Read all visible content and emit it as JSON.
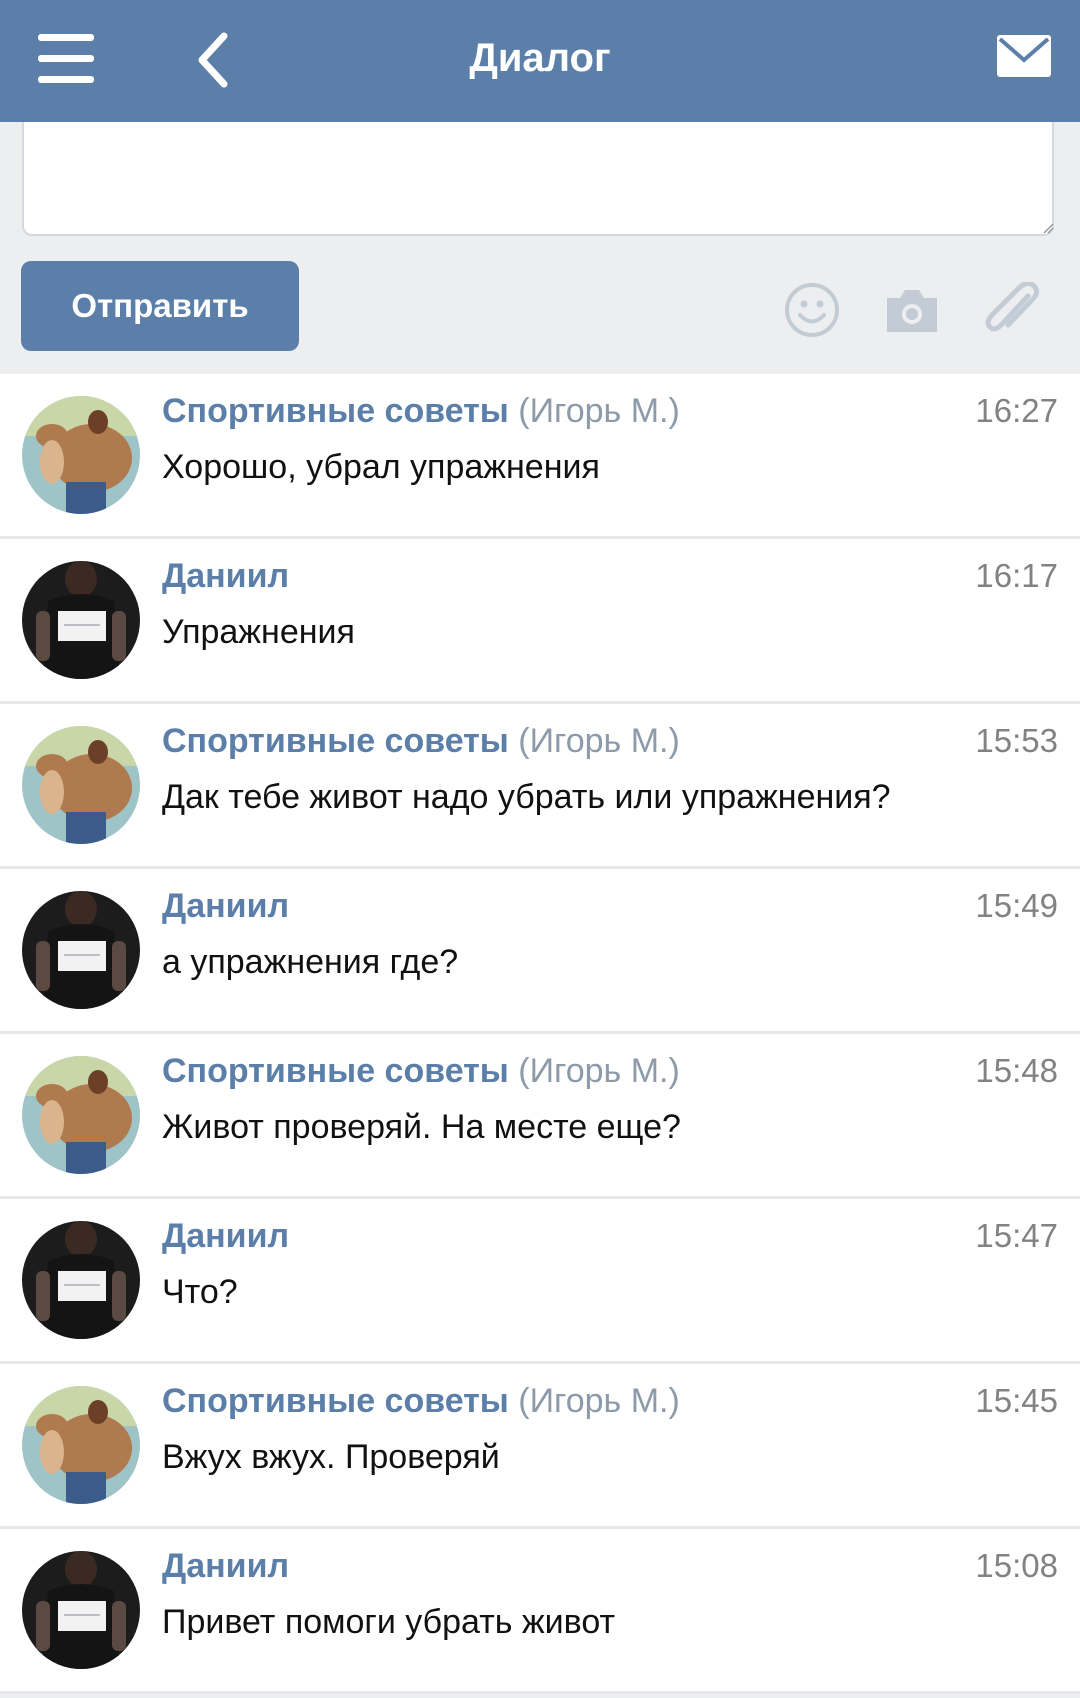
{
  "header": {
    "title": "Диалог",
    "menu_icon": "hamburger-icon",
    "back_icon": "chevron-left-icon",
    "mail_icon": "envelope-icon"
  },
  "composer": {
    "message_value": "",
    "send_label": "Отправить",
    "tools": [
      "emoji-icon",
      "camera-icon",
      "paperclip-icon"
    ]
  },
  "colors": {
    "header_bg": "#5b7fa8",
    "accent": "#5b7fa8",
    "page_bg": "#edeef0"
  },
  "messages": [
    {
      "sender": "Спортивные советы",
      "sender_sub": "(Игорь М.)",
      "time": "16:27",
      "text": "Хорошо, убрал упражнения",
      "avatar": "bodybuilder"
    },
    {
      "sender": "Даниил",
      "sender_sub": "",
      "time": "16:17",
      "text": "Упражнения",
      "avatar": "person-sign"
    },
    {
      "sender": "Спортивные советы",
      "sender_sub": "(Игорь М.)",
      "time": "15:53",
      "text": "Дак тебе живот надо убрать или упражнения?",
      "avatar": "bodybuilder"
    },
    {
      "sender": "Даниил",
      "sender_sub": "",
      "time": "15:49",
      "text": "а упражнения где?",
      "avatar": "person-sign"
    },
    {
      "sender": "Спортивные советы",
      "sender_sub": "(Игорь М.)",
      "time": "15:48",
      "text": "Живот проверяй. На месте еще?",
      "avatar": "bodybuilder"
    },
    {
      "sender": "Даниил",
      "sender_sub": "",
      "time": "15:47",
      "text": "Что?",
      "avatar": "person-sign"
    },
    {
      "sender": "Спортивные советы",
      "sender_sub": "(Игорь М.)",
      "time": "15:45",
      "text": "Вжух вжух. Проверяй",
      "avatar": "bodybuilder"
    },
    {
      "sender": "Даниил",
      "sender_sub": "",
      "time": "15:08",
      "text": "Привет помоги убрать живот",
      "avatar": "person-sign"
    }
  ]
}
